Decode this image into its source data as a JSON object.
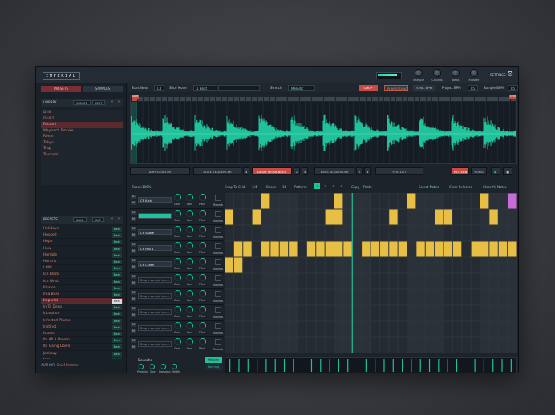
{
  "app": {
    "logo": "IMPERIAL",
    "top_knobs": [
      {
        "label": "Sample"
      },
      {
        "label": "Chords"
      },
      {
        "label": "Bass"
      },
      {
        "label": "Master"
      }
    ],
    "settings_label": "SETTINGS",
    "level_meter": 0.8
  },
  "left": {
    "tab_presets": "PRESETS",
    "tab_samples": "SAMPLES",
    "library_title": "LIBRARY",
    "library_create": "CREATE",
    "library_edit": "EDIT",
    "library_items": [
      {
        "label": "Drill",
        "selected": false
      },
      {
        "label": "Drill 2",
        "selected": false
      },
      {
        "label": "Factory",
        "selected": true
      },
      {
        "label": "Maybach Empire",
        "selected": false
      },
      {
        "label": "Ronin",
        "selected": false
      },
      {
        "label": "Tokyo",
        "selected": false
      },
      {
        "label": "Trap",
        "selected": false
      },
      {
        "label": "Tsunami",
        "selected": false
      }
    ],
    "presets_title": "PRESETS",
    "presets_save": "SAVE",
    "presets_init": "INIT",
    "presets": [
      {
        "label": "Holidays",
        "tag": "Beat",
        "selected": false
      },
      {
        "label": "Hooked",
        "tag": "Beat",
        "selected": false
      },
      {
        "label": "Hope",
        "tag": "Beat",
        "selected": false
      },
      {
        "label": "How",
        "tag": "Beat",
        "selected": false
      },
      {
        "label": "Humble",
        "tag": "Beat",
        "selected": false
      },
      {
        "label": "Hunchs",
        "tag": "Beat",
        "selected": false
      },
      {
        "label": "I Will",
        "tag": "Beat",
        "selected": false
      },
      {
        "label": "Ice Block",
        "tag": "Beat",
        "selected": false
      },
      {
        "label": "Ice Wrist",
        "tag": "Beat",
        "selected": false
      },
      {
        "label": "Illusion",
        "tag": "Beat",
        "selected": false
      },
      {
        "label": "Ima Boss",
        "tag": "Beat",
        "selected": false
      },
      {
        "label": "Imperial",
        "tag": "Beat",
        "selected": true
      },
      {
        "label": "In To Deep",
        "tag": "Beat",
        "selected": false
      },
      {
        "label": "Inception",
        "tag": "Beat",
        "selected": false
      },
      {
        "label": "Infected Plucks",
        "tag": "Beat",
        "selected": false
      },
      {
        "label": "Instinct",
        "tag": "Beat",
        "selected": false
      },
      {
        "label": "Issues",
        "tag": "Beat",
        "selected": false
      },
      {
        "label": "Its All A Dream",
        "tag": "Beat",
        "selected": false
      },
      {
        "label": "Its Going Down",
        "tag": "Beat",
        "selected": false
      },
      {
        "label": "Jackboy",
        "tag": "Beat",
        "selected": false
      },
      {
        "label": "Jam",
        "tag": "Beat",
        "selected": false
      },
      {
        "label": "Japan",
        "tag": "Beat",
        "selected": false
      }
    ],
    "author_label": "AUTHOR:",
    "author_name": "Chief Premier"
  },
  "controls": {
    "start_note_label": "Start Note",
    "start_note_value": "C4",
    "slice_mode_label": "Slice Mode",
    "slice_mode_value": "1 Beat",
    "stretch_label": "Stretch",
    "stretch_value": "Melodic",
    "chop": "CHOP",
    "playtosync": "PLAYTOSYNC",
    "syncbpm": "SYNC BPM",
    "project_bpm_label": "Project BPM",
    "project_bpm_value": "85",
    "sample_bpm_label": "Sample BPM",
    "sample_bpm_value": "85",
    "start_marker": "Start",
    "end_marker": "End"
  },
  "seq_tabs": {
    "arp": "ARPEGGIATOR",
    "slice": "SLICE SEQUENCER",
    "drum": "DRUM SEQUENCER",
    "drum_num": "2",
    "bass": "BASS SEQUENCER",
    "bass_num": "3",
    "playlist": "PLAYLIST",
    "pattern": "PATTERN",
    "song": "SONG"
  },
  "seq_toolbar": {
    "zoom_label": "Zoom:",
    "zoom_value": "100%",
    "snap_label": "Snap To Grid:",
    "snap_value": "1/4",
    "beats_label": "Beats:",
    "beats_value": "16",
    "pattern_label": "Pattern:",
    "patterns": [
      "1",
      "2",
      "3",
      "4"
    ],
    "copy": "Copy",
    "paste": "Paste",
    "select_notes": "Select Notes",
    "clear_selected": "Clear Selected",
    "clear_all": "Clear All Notes"
  },
  "tracks": [
    {
      "name": "CP Kick",
      "style": "named"
    },
    {
      "name": "",
      "style": "teal"
    },
    {
      "name": "CP Snare",
      "style": "named"
    },
    {
      "name": "CP HAt 1",
      "style": "named"
    },
    {
      "name": "CP Crash",
      "style": "named"
    },
    {
      "name": "Drag a sample here...",
      "style": "drag"
    },
    {
      "name": "Drag a sample here...",
      "style": "drag"
    },
    {
      "name": "Drag a sample here...",
      "style": "drag"
    },
    {
      "name": "Drag a sample here...",
      "style": "drag"
    },
    {
      "name": "Drag a sample here...",
      "style": "drag"
    }
  ],
  "track_labels": {
    "gain": "Gain",
    "pan": "Pan",
    "pitch": "Pitch",
    "reverb": "Reverb",
    "solo": "SC",
    "mute": "M"
  },
  "reverbs": {
    "title": "Reverbs",
    "knobs": [
      "Predelay",
      "Size",
      "Damping",
      "Width"
    ]
  },
  "velocity_tabs": {
    "velocity": "Velocity",
    "panning": "Panning"
  },
  "grid": {
    "steps": 32,
    "rows": [
      [
        0,
        0,
        0,
        0,
        1,
        0,
        0,
        0,
        0,
        0,
        0,
        0,
        1,
        0,
        0,
        0,
        0,
        0,
        0,
        0,
        1,
        0,
        0,
        0,
        0,
        0,
        0,
        0,
        1,
        0,
        0,
        0
      ],
      [
        1,
        0,
        0,
        1,
        0,
        0,
        0,
        0,
        0,
        0,
        0,
        1,
        1,
        0,
        0,
        0,
        0,
        0,
        1,
        0,
        0,
        0,
        0,
        1,
        1,
        0,
        0,
        0,
        0,
        1,
        0,
        0
      ],
      [
        0,
        0,
        0,
        0,
        0,
        0,
        0,
        0,
        0,
        0,
        0,
        0,
        0,
        0,
        0,
        0,
        0,
        0,
        0,
        0,
        0,
        0,
        0,
        0,
        0,
        0,
        0,
        0,
        0,
        0,
        0,
        0
      ],
      [
        0,
        1,
        1,
        0,
        1,
        1,
        1,
        1,
        0,
        1,
        1,
        1,
        1,
        1,
        0,
        1,
        1,
        1,
        1,
        1,
        0,
        1,
        1,
        1,
        1,
        1,
        0,
        1,
        1,
        1,
        1,
        1
      ],
      [
        1,
        1,
        0,
        0,
        0,
        0,
        0,
        0,
        0,
        0,
        0,
        0,
        0,
        0,
        0,
        0,
        0,
        0,
        0,
        0,
        0,
        0,
        0,
        0,
        0,
        0,
        0,
        0,
        0,
        0,
        0,
        0
      ],
      [
        0,
        0,
        0,
        0,
        0,
        0,
        0,
        0,
        0,
        0,
        0,
        0,
        0,
        0,
        0,
        0,
        0,
        0,
        0,
        0,
        0,
        0,
        0,
        0,
        0,
        0,
        0,
        0,
        0,
        0,
        0,
        0
      ],
      [
        0,
        0,
        0,
        0,
        0,
        0,
        0,
        0,
        0,
        0,
        0,
        0,
        0,
        0,
        0,
        0,
        0,
        0,
        0,
        0,
        0,
        0,
        0,
        0,
        0,
        0,
        0,
        0,
        0,
        0,
        0,
        0
      ],
      [
        0,
        0,
        0,
        0,
        0,
        0,
        0,
        0,
        0,
        0,
        0,
        0,
        0,
        0,
        0,
        0,
        0,
        0,
        0,
        0,
        0,
        0,
        0,
        0,
        0,
        0,
        0,
        0,
        0,
        0,
        0,
        0
      ],
      [
        0,
        0,
        0,
        0,
        0,
        0,
        0,
        0,
        0,
        0,
        0,
        0,
        0,
        0,
        0,
        0,
        0,
        0,
        0,
        0,
        0,
        0,
        0,
        0,
        0,
        0,
        0,
        0,
        0,
        0,
        0,
        0
      ],
      [
        0,
        0,
        0,
        0,
        0,
        0,
        0,
        0,
        0,
        0,
        0,
        0,
        0,
        0,
        0,
        0,
        0,
        0,
        0,
        0,
        0,
        0,
        0,
        0,
        0,
        0,
        0,
        0,
        0,
        0,
        0,
        0
      ]
    ],
    "playhead_step": 14,
    "note_color": "#e8bf45",
    "accent_color": "#1fc29a"
  },
  "colors": {
    "accent": "#1fc29a",
    "red": "#c84a44",
    "list_text": "#d8826d"
  }
}
